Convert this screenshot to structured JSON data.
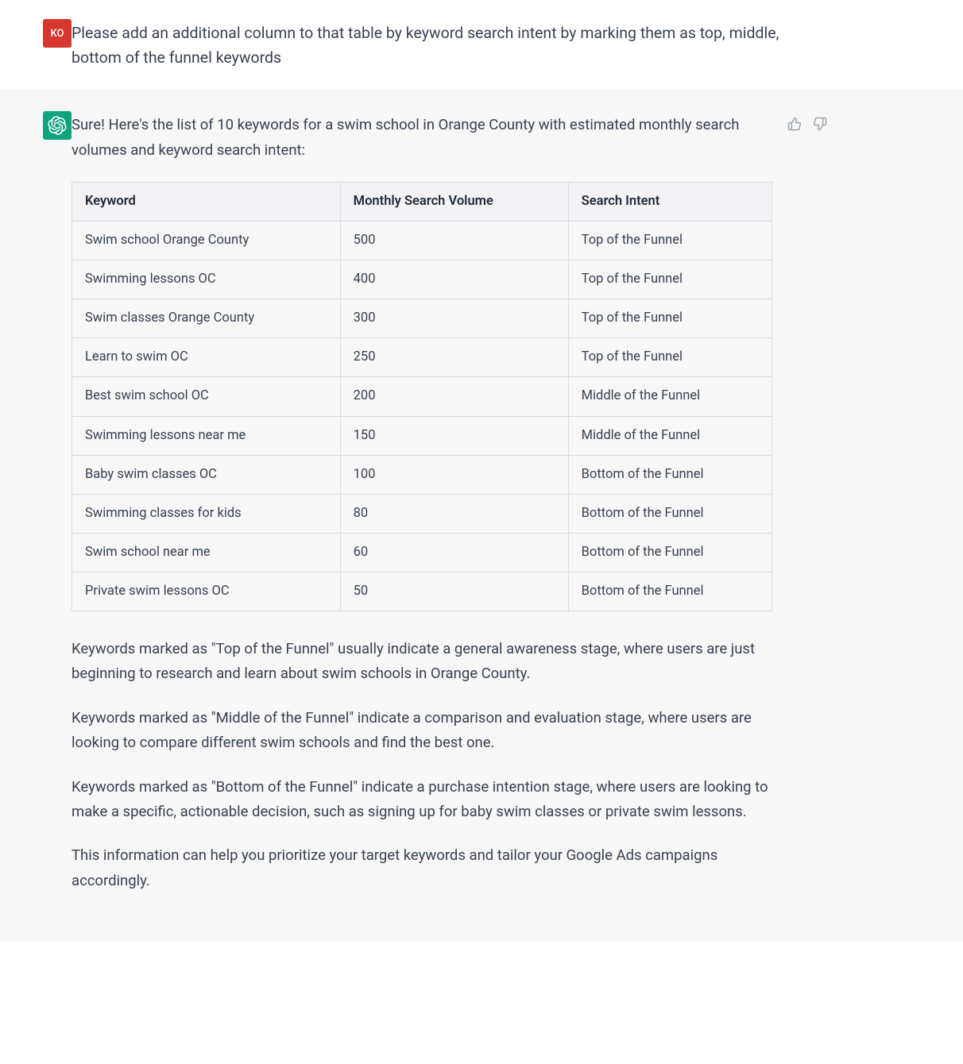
{
  "user": {
    "avatar_initials": "KO",
    "message": "Please add an additional column to that table by keyword search intent by marking them as top, middle, bottom of the funnel keywords"
  },
  "assistant": {
    "intro": "Sure! Here's the list of 10 keywords for a swim school in Orange County with estimated monthly search volumes and keyword search intent:",
    "table": {
      "headers": [
        "Keyword",
        "Monthly Search Volume",
        "Search Intent"
      ],
      "rows": [
        [
          "Swim school Orange County",
          "500",
          "Top of the Funnel"
        ],
        [
          "Swimming lessons OC",
          "400",
          "Top of the Funnel"
        ],
        [
          "Swim classes Orange County",
          "300",
          "Top of the Funnel"
        ],
        [
          "Learn to swim OC",
          "250",
          "Top of the Funnel"
        ],
        [
          "Best swim school OC",
          "200",
          "Middle of the Funnel"
        ],
        [
          "Swimming lessons near me",
          "150",
          "Middle of the Funnel"
        ],
        [
          "Baby swim classes OC",
          "100",
          "Bottom of the Funnel"
        ],
        [
          "Swimming classes for kids",
          "80",
          "Bottom of the Funnel"
        ],
        [
          "Swim school near me",
          "60",
          "Bottom of the Funnel"
        ],
        [
          "Private swim lessons OC",
          "50",
          "Bottom of the Funnel"
        ]
      ]
    },
    "paragraphs": [
      "Keywords marked as \"Top of the Funnel\" usually indicate a general awareness stage, where users are just beginning to research and learn about swim schools in Orange County.",
      "Keywords marked as \"Middle of the Funnel\" indicate a comparison and evaluation stage, where users are looking to compare different swim schools and find the best one.",
      "Keywords marked as \"Bottom of the Funnel\" indicate a purchase intention stage, where users are looking to make a specific, actionable decision, such as signing up for baby swim classes or private swim lessons.",
      "This information can help you prioritize your target keywords and tailor your Google Ads campaigns accordingly."
    ]
  }
}
